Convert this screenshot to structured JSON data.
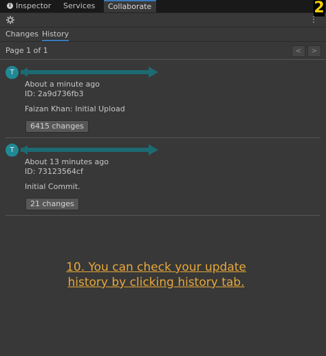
{
  "tabs": [
    {
      "label": "Inspector",
      "icon": "info-icon"
    },
    {
      "label": "Services"
    },
    {
      "label": "Collaborate",
      "active": true
    }
  ],
  "corner_logo": "2",
  "subtabs": [
    {
      "label": "Changes"
    },
    {
      "label": "History",
      "active": true
    }
  ],
  "pagination": {
    "label": "Page 1 of 1",
    "prev": "<",
    "next": ">"
  },
  "entries": [
    {
      "avatar": "T",
      "time": "About a minute ago",
      "id": "ID: 2a9d736fb3",
      "message": "Faizan Khan: Initial Upload",
      "changes": "6415 changes"
    },
    {
      "avatar": "T",
      "time": "About 13 minutes ago",
      "id": "ID: 73123564cf",
      "message": "Initial Commit.",
      "changes": "21 changes"
    }
  ],
  "caption": {
    "line1": "10. You can check your update",
    "line2": "history by clicking history tab."
  },
  "colors": {
    "accent": "#3a79bb",
    "avatar": "#1f8a96",
    "caption": "#e8a83a",
    "redaction": "#1c6b73"
  }
}
